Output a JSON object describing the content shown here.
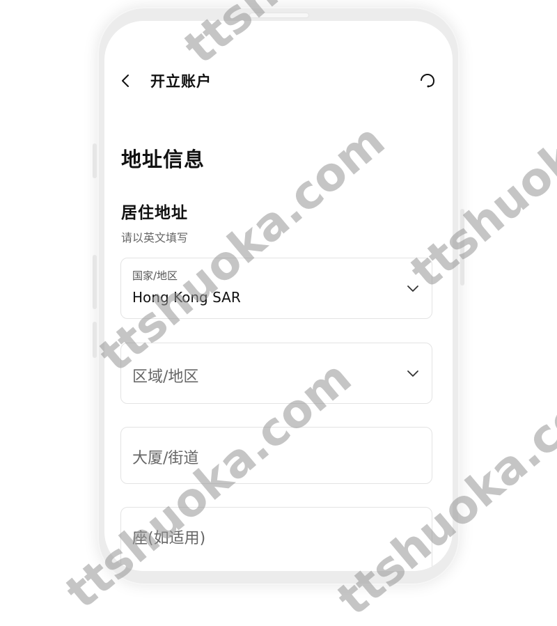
{
  "header": {
    "title": "开立账户",
    "back_icon": "chevron-left-icon",
    "support_icon": "headset-icon"
  },
  "section": {
    "heading": "地址信息",
    "subheading": "居住地址",
    "hint": "请以英文填写"
  },
  "fields": {
    "country": {
      "label": "国家/地区",
      "value": "Hong Kong SAR",
      "icon": "chevron-down-icon"
    },
    "district": {
      "placeholder": "区域/地区",
      "icon": "chevron-down-icon"
    },
    "building": {
      "placeholder": "大厦/街道"
    },
    "block": {
      "placeholder": "座(如适用)"
    }
  },
  "watermark": {
    "text": "ttshuoka.com"
  },
  "colors": {
    "text": "#111111",
    "muted": "#666666",
    "border": "#e3e3e3"
  }
}
